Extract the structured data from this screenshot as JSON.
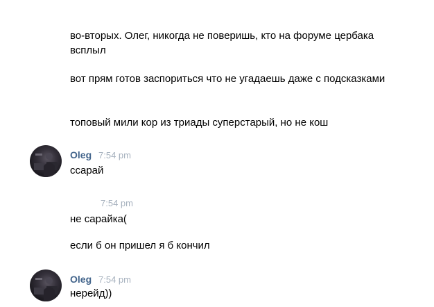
{
  "messages_block_1": {
    "lines": [
      "во-вторых. Олег, никогда не поверишь, кто на форуме цербака всплыл",
      "вот прям готов заспориться что не угадаешь даже с подсказками",
      "топовый мили кор из триады суперстарый, но не кош"
    ]
  },
  "group_oleg_1": {
    "author": "Oleg",
    "time": "7:54 pm",
    "avatar_icon": "user-avatar-photo",
    "text": "ссарай"
  },
  "group_self_2": {
    "time": "7:54 pm",
    "lines": [
      "не сарайка(",
      "если б он пришел я б кончил"
    ]
  },
  "group_oleg_3": {
    "author": "Oleg",
    "time": "7:54 pm",
    "avatar_icon": "user-avatar-photo",
    "text": "нерейд))"
  },
  "colors": {
    "author_link": "#42648b",
    "timestamp": "#a5b0bd",
    "text": "#000000",
    "background": "#ffffff"
  }
}
